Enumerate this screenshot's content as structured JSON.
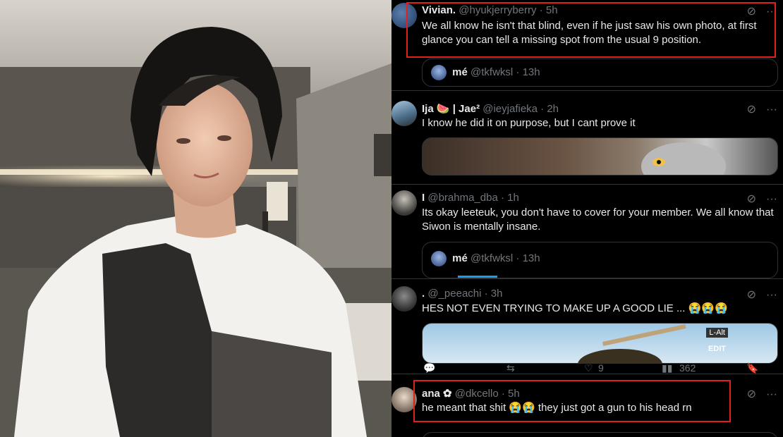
{
  "tweets": [
    {
      "name": "Vivian.",
      "meta": "@hyukjerryberry · 5h",
      "text": "We all know he isn't that blind, even if  he just saw his own photo, at first glance you can tell a missing spot from the usual 9 position.",
      "quote": {
        "name": "mé",
        "meta": "@tkfwksl · 13h"
      }
    },
    {
      "name": "Ija 🍉 | Jae²",
      "meta": "@ieyjafieka · 2h",
      "text": "I know he did it on purpose, but I cant prove it"
    },
    {
      "name": "I",
      "meta": "@brahma_dba · 1h",
      "text": "Its okay leeteuk, you don't have to cover for your member. We all know that Siwon is mentally insane.",
      "quote": {
        "name": "mé",
        "meta": "@tkfwksl · 13h"
      }
    },
    {
      "name": ".",
      "meta": "@_peeachi · 3h",
      "text": "HES NOT EVEN TRYING TO MAKE UP A GOOD LIE ... 😭😭😭",
      "media_labels": [
        "L-Alt",
        "EDIT"
      ],
      "actions": {
        "likes": "9",
        "views": "362"
      }
    },
    {
      "name": "ana ✿",
      "meta": "@dkcello · 5h",
      "text": "he meant that shit 😭😭 they just got a gun to his head rn"
    }
  ],
  "icons": {
    "grok": "grok-icon",
    "more": "more-icon"
  },
  "colors": {
    "highlight": "#e0201f",
    "muted": "#71767b",
    "text": "#e7e9ea"
  }
}
